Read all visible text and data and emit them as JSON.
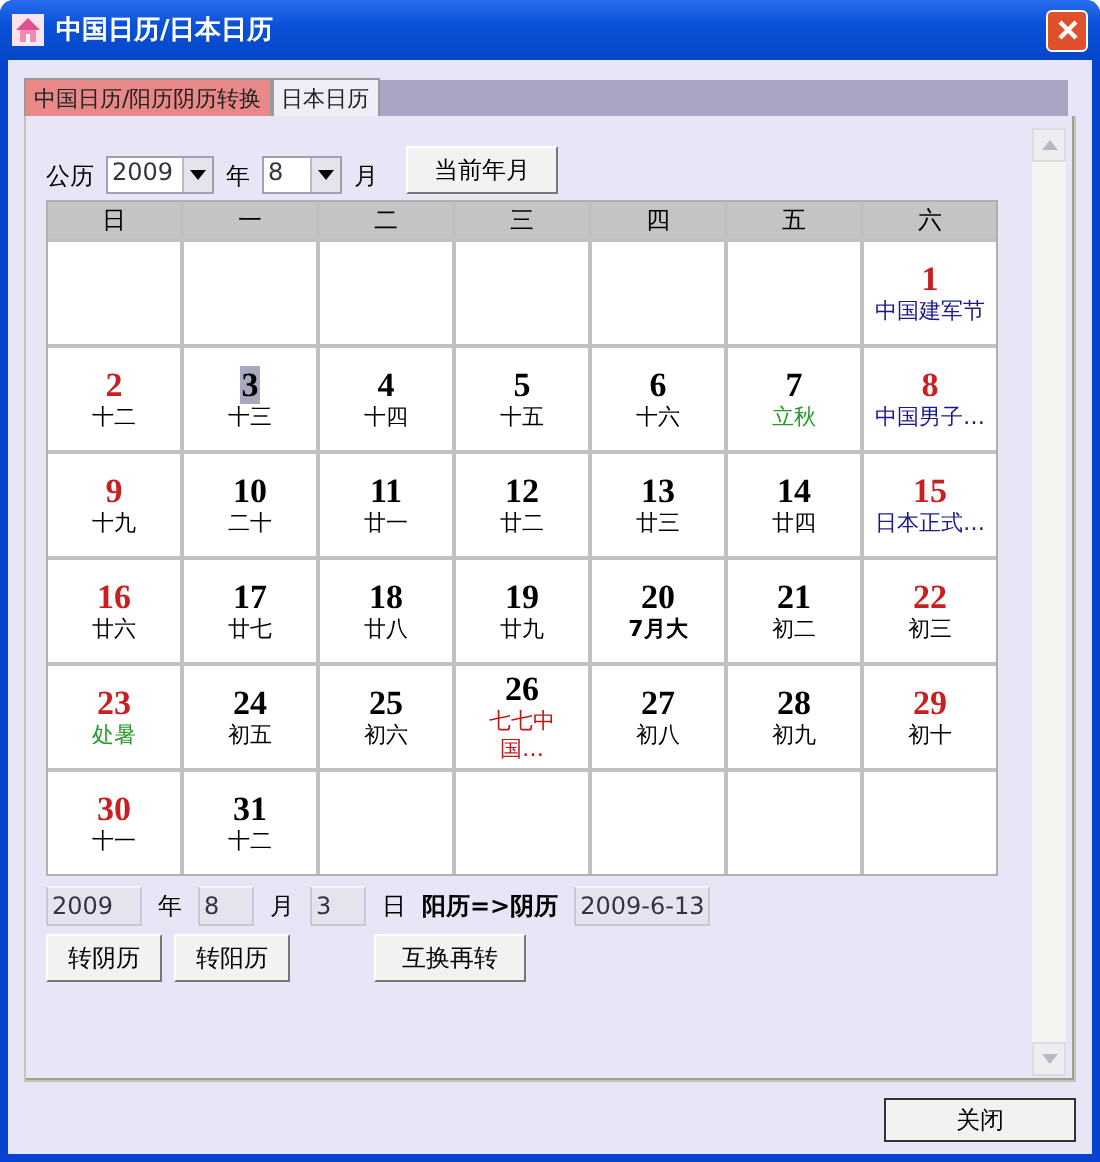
{
  "window": {
    "title": "中国日历/日本日历"
  },
  "tabs": [
    {
      "label": "中国日历/阳历阴历转换",
      "selected": true
    },
    {
      "label": "日本日历",
      "selected": false
    }
  ],
  "toolbar": {
    "era_label": "公历",
    "year": "2009",
    "year_label": "年",
    "month": "8",
    "month_label": "月",
    "current_button": "当前年月"
  },
  "weekdays": [
    "日",
    "一",
    "二",
    "三",
    "四",
    "五",
    "六"
  ],
  "weeks": [
    [
      {
        "day": "1",
        "weekend": true,
        "selected": false,
        "sub": "中国建军节",
        "kind": "festival"
      }
    ],
    [
      {
        "day": "2",
        "weekend": true,
        "selected": false,
        "sub": "十二",
        "kind": "lunar"
      },
      {
        "day": "3",
        "weekend": false,
        "selected": true,
        "sub": "十三",
        "kind": "lunar"
      },
      {
        "day": "4",
        "weekend": false,
        "selected": false,
        "sub": "十四",
        "kind": "lunar"
      },
      {
        "day": "5",
        "weekend": false,
        "selected": false,
        "sub": "十五",
        "kind": "lunar"
      },
      {
        "day": "6",
        "weekend": false,
        "selected": false,
        "sub": "十六",
        "kind": "lunar"
      },
      {
        "day": "7",
        "weekend": false,
        "selected": false,
        "sub": "立秋",
        "kind": "term"
      },
      {
        "day": "8",
        "weekend": true,
        "selected": false,
        "sub": "中国男子…",
        "kind": "festival"
      }
    ],
    [
      {
        "day": "9",
        "weekend": true,
        "selected": false,
        "sub": "十九",
        "kind": "lunar"
      },
      {
        "day": "10",
        "weekend": false,
        "selected": false,
        "sub": "二十",
        "kind": "lunar"
      },
      {
        "day": "11",
        "weekend": false,
        "selected": false,
        "sub": "廿一",
        "kind": "lunar"
      },
      {
        "day": "12",
        "weekend": false,
        "selected": false,
        "sub": "廿二",
        "kind": "lunar"
      },
      {
        "day": "13",
        "weekend": false,
        "selected": false,
        "sub": "廿三",
        "kind": "lunar"
      },
      {
        "day": "14",
        "weekend": false,
        "selected": false,
        "sub": "廿四",
        "kind": "lunar"
      },
      {
        "day": "15",
        "weekend": true,
        "selected": false,
        "sub": "日本正式…",
        "kind": "festival"
      }
    ],
    [
      {
        "day": "16",
        "weekend": true,
        "selected": false,
        "sub": "廿六",
        "kind": "lunar"
      },
      {
        "day": "17",
        "weekend": false,
        "selected": false,
        "sub": "廿七",
        "kind": "lunar"
      },
      {
        "day": "18",
        "weekend": false,
        "selected": false,
        "sub": "廿八",
        "kind": "lunar"
      },
      {
        "day": "19",
        "weekend": false,
        "selected": false,
        "sub": "廿九",
        "kind": "lunar"
      },
      {
        "day": "20",
        "weekend": false,
        "selected": false,
        "sub": "7月大",
        "kind": "month"
      },
      {
        "day": "21",
        "weekend": false,
        "selected": false,
        "sub": "初二",
        "kind": "lunar"
      },
      {
        "day": "22",
        "weekend": true,
        "selected": false,
        "sub": "初三",
        "kind": "lunar"
      }
    ],
    [
      {
        "day": "23",
        "weekend": true,
        "selected": false,
        "sub": "处暑",
        "kind": "term"
      },
      {
        "day": "24",
        "weekend": false,
        "selected": false,
        "sub": "初五",
        "kind": "lunar"
      },
      {
        "day": "25",
        "weekend": false,
        "selected": false,
        "sub": "初六",
        "kind": "lunar"
      },
      {
        "day": "26",
        "weekend": false,
        "selected": false,
        "sub": "七七中国…",
        "kind": "holiday"
      },
      {
        "day": "27",
        "weekend": false,
        "selected": false,
        "sub": "初八",
        "kind": "lunar"
      },
      {
        "day": "28",
        "weekend": false,
        "selected": false,
        "sub": "初九",
        "kind": "lunar"
      },
      {
        "day": "29",
        "weekend": true,
        "selected": false,
        "sub": "初十",
        "kind": "lunar"
      }
    ],
    [
      {
        "day": "30",
        "weekend": true,
        "selected": false,
        "sub": "十一",
        "kind": "lunar"
      },
      {
        "day": "31",
        "weekend": false,
        "selected": false,
        "sub": "十二",
        "kind": "lunar"
      }
    ]
  ],
  "converter": {
    "year": "2009",
    "year_label": "年",
    "month": "8",
    "month_label": "月",
    "day": "3",
    "day_label": "日",
    "direction": "阳历=>阴历",
    "result": "2009-6-13"
  },
  "buttons": [
    "转阴历",
    "转阳历",
    "互换再转"
  ],
  "close_button": "关闭"
}
